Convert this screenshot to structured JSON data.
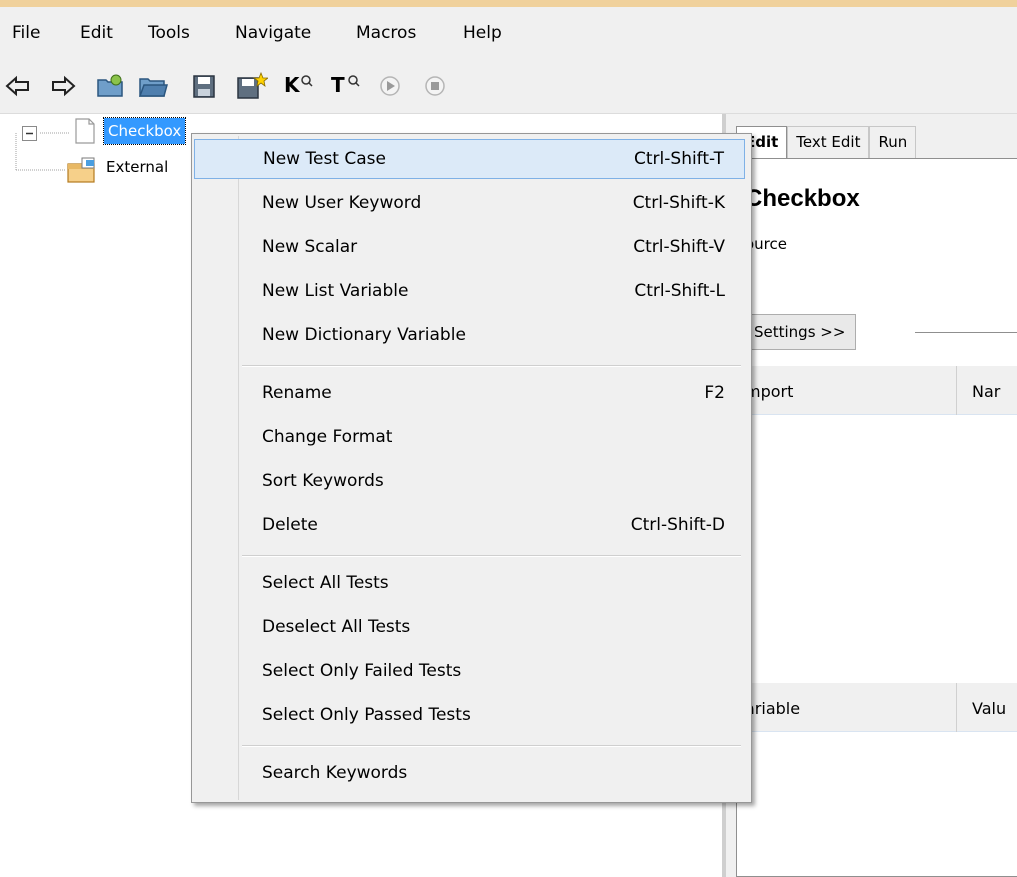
{
  "menubar": {
    "items": [
      "File",
      "Edit",
      "Tools",
      "Navigate",
      "Macros",
      "Help"
    ]
  },
  "toolbar": {
    "icons": [
      "back-arrow-icon",
      "forward-arrow-icon",
      "open-folder-icon",
      "folder-icon",
      "save-icon",
      "save-all-icon",
      "keyword-search-icon",
      "test-search-icon",
      "run-icon",
      "stop-icon"
    ],
    "keyword_letter": "K",
    "test_letter": "T"
  },
  "tree": {
    "suite_label": "Checkbox",
    "external_label": "External"
  },
  "editor": {
    "tabs": [
      "Edit",
      "Text Edit",
      "Run"
    ],
    "title": "Checkbox",
    "source_label": "ource",
    "settings_button": "Settings >>",
    "import_table": {
      "headers": [
        "mport",
        "Nar"
      ]
    },
    "variable_table": {
      "headers": [
        "ariable",
        "Valu"
      ]
    }
  },
  "context_menu": {
    "items": [
      {
        "label": "New Test Case",
        "shortcut": "Ctrl-Shift-T"
      },
      {
        "label": "New User Keyword",
        "shortcut": "Ctrl-Shift-K"
      },
      {
        "label": "New Scalar",
        "shortcut": "Ctrl-Shift-V"
      },
      {
        "label": "New List Variable",
        "shortcut": "Ctrl-Shift-L"
      },
      {
        "label": "New Dictionary Variable",
        "shortcut": ""
      },
      {
        "label": "Rename",
        "shortcut": "F2"
      },
      {
        "label": "Change Format",
        "shortcut": ""
      },
      {
        "label": "Sort Keywords",
        "shortcut": ""
      },
      {
        "label": "Delete",
        "shortcut": "Ctrl-Shift-D"
      },
      {
        "label": "Select All Tests",
        "shortcut": ""
      },
      {
        "label": "Deselect All Tests",
        "shortcut": ""
      },
      {
        "label": "Select Only Failed Tests",
        "shortcut": ""
      },
      {
        "label": "Select Only Passed Tests",
        "shortcut": ""
      },
      {
        "label": "Search Keywords",
        "shortcut": ""
      }
    ],
    "highlighted_item": "New Test Case"
  },
  "colors": {
    "selection": "#3399ff",
    "menu_highlight": "#dceaf8",
    "title_strip": "#f0d19c"
  }
}
